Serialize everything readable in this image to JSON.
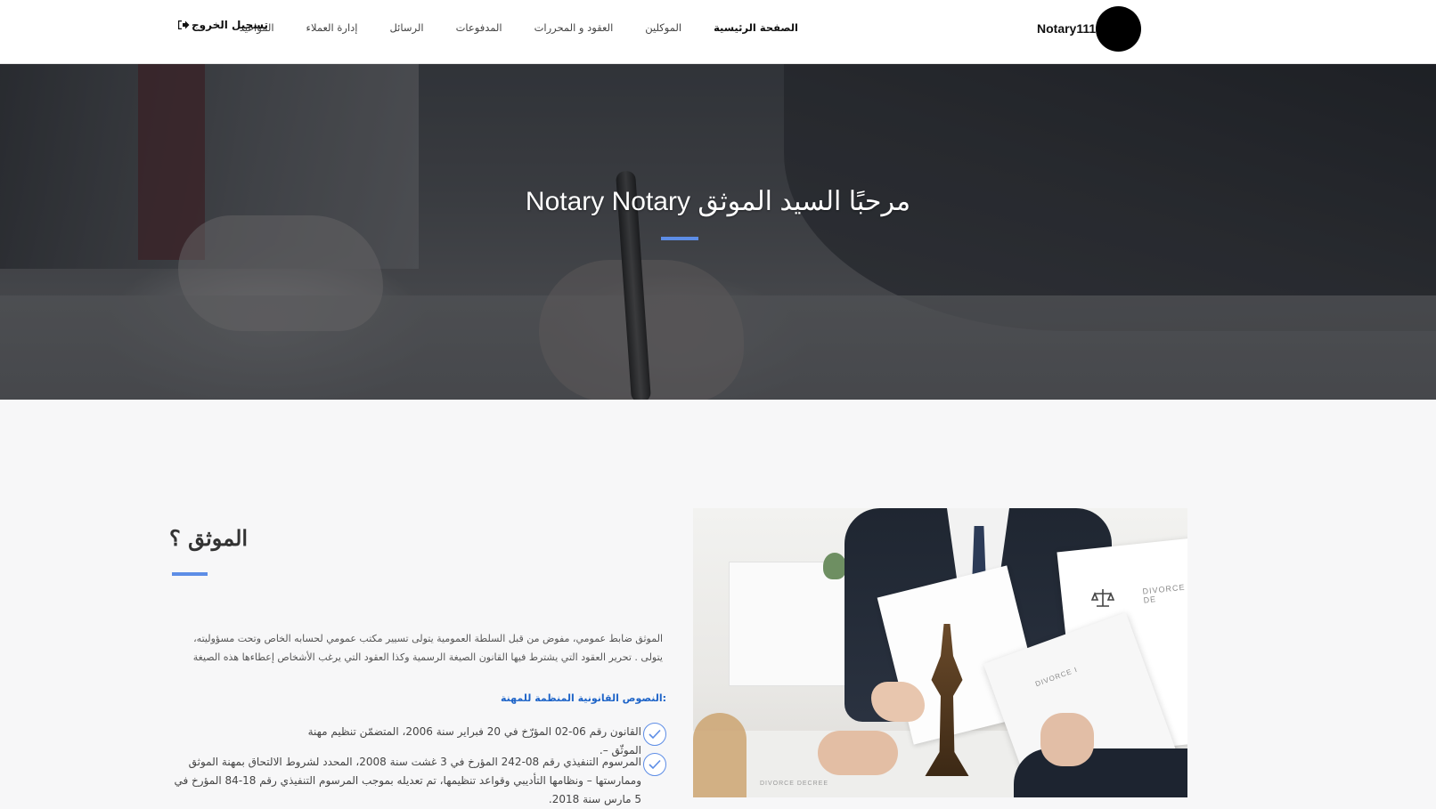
{
  "nav": {
    "brand": "Notary111",
    "items": [
      {
        "label": "الصفحة الرئيسية",
        "active": true
      },
      {
        "label": "الموكلين",
        "active": false
      },
      {
        "label": "العقود و المحررات",
        "active": false
      },
      {
        "label": "المدفوعات",
        "active": false
      },
      {
        "label": "الرسائل",
        "active": false
      },
      {
        "label": "إدارة العملاء",
        "active": false
      },
      {
        "label": "المواعيد",
        "active": false
      }
    ],
    "logout_label": "تسجيل الخروج",
    "logout_icon": "sign-out-icon"
  },
  "hero": {
    "title": "Notary Notary مرحبًا السيد الموثق"
  },
  "about": {
    "title": "الموثق ؟",
    "text": "الموثق ضابط عمومي، مفوض من قبل السلطة العمومية يتولى تسيير مكتب عمومي لحسابه الخاص وتحت مسؤوليته، يتولى . تحرير العقود التي يشترط فيها القانون الصيغة الرسمية وكذا العقود التي يرغب الأشخاص إعطاءها هذه الصيغة",
    "legal_heading": ":النصوص القانونية المنظمة للمهنة",
    "legal_items": [
      "القانون رقم 06-02 المؤرّخ في 20 فبراير سنة 2006، المتضمّن تنظيم مهنة الموثّق –.",
      "المرسوم التنفيذي رقم 08-242 المؤرخ في 3 غشت سنة 2008، المحدد لشروط الالتحاق بمهنة الموثق وممارستها – ونظامها التأديبي وقواعد تنظيمها، تم تعديله بموجب المرسوم التنفيذي رقم 18-84 المؤرخ في 5 مارس سنة 2018."
    ]
  },
  "photo": {
    "doc_label_1": "DIVORCE DE",
    "doc_label_2": "DIVORCE I",
    "doc_label_3": "DIVORCE DECREE"
  },
  "colors": {
    "accent": "#5d8de6",
    "link_blue": "#1e64c8"
  }
}
